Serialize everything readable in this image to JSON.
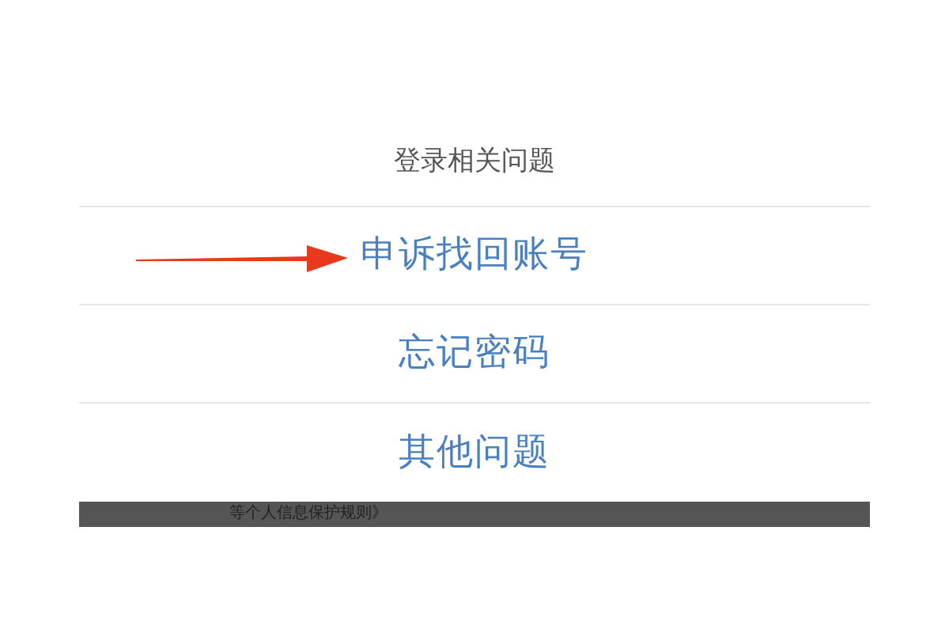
{
  "sheet": {
    "title": "登录相关问题",
    "options": [
      {
        "label": "申诉找回账号",
        "highlighted": true
      },
      {
        "label": "忘记密码",
        "highlighted": false
      },
      {
        "label": "其他问题",
        "highlighted": false
      }
    ]
  },
  "background_text": "等个人信息保护规则》"
}
